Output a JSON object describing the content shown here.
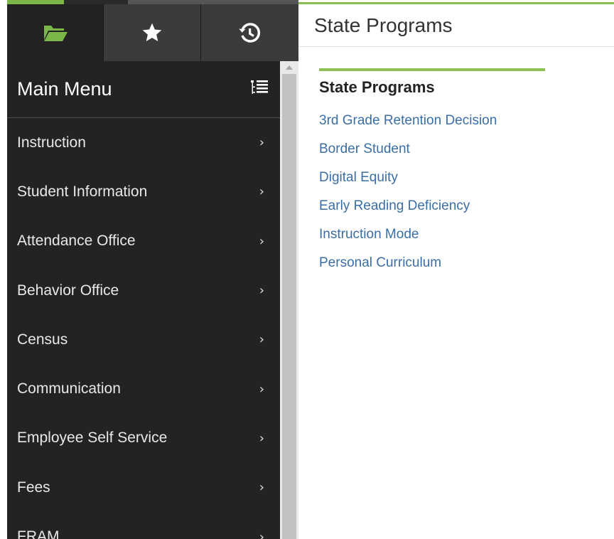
{
  "sidebar": {
    "tabs": [
      {
        "icon": "folder-icon",
        "color": "#7ab648"
      },
      {
        "icon": "star-icon",
        "color": "#ffffff"
      },
      {
        "icon": "history-icon",
        "color": "#ffffff"
      }
    ],
    "menu_title": "Main Menu",
    "menu_icon": "list-tree-icon",
    "items": [
      {
        "label": "Instruction"
      },
      {
        "label": "Student Information"
      },
      {
        "label": "Attendance Office"
      },
      {
        "label": "Behavior Office"
      },
      {
        "label": "Census"
      },
      {
        "label": "Communication"
      },
      {
        "label": "Employee Self Service"
      },
      {
        "label": "Fees"
      },
      {
        "label": "FRAM"
      }
    ]
  },
  "main": {
    "page_title": "State Programs",
    "section_title": "State Programs",
    "links": [
      {
        "label": "3rd Grade Retention Decision"
      },
      {
        "label": "Border Student"
      },
      {
        "label": "Digital Equity"
      },
      {
        "label": "Early Reading Deficiency"
      },
      {
        "label": "Instruction Mode"
      },
      {
        "label": "Personal Curriculum"
      }
    ]
  },
  "colors": {
    "accent_green": "#8cc152",
    "link_blue": "#3a6ea5",
    "sidebar_bg": "#222222"
  }
}
